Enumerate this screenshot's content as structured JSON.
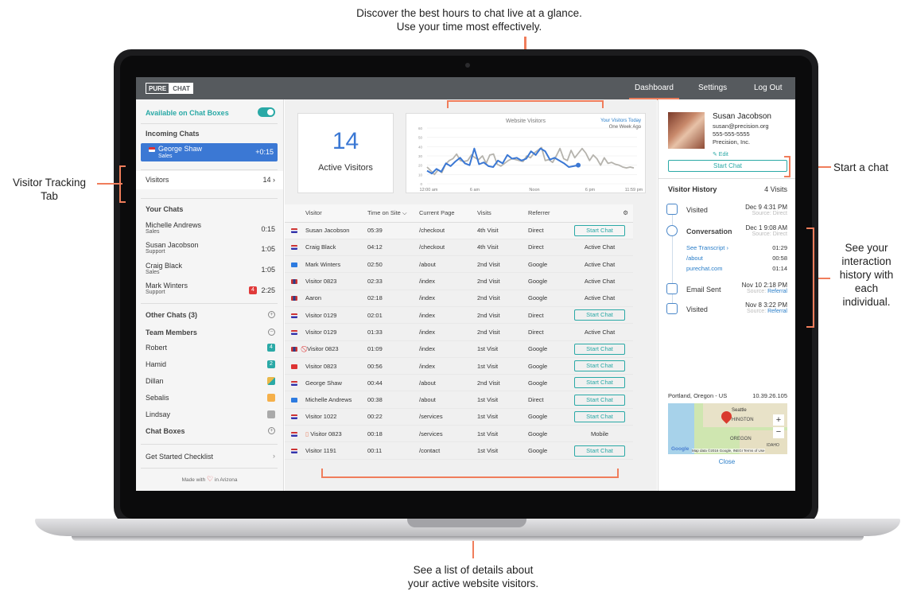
{
  "callouts": {
    "top": [
      "Discover the best hours to chat live at a glance.",
      "Use your time most effectively."
    ],
    "left": [
      "Visitor Tracking",
      "Tab"
    ],
    "right_start": "Start a chat",
    "right_history": [
      "See your",
      "interaction",
      "history with",
      "each",
      "individual."
    ],
    "bottom": [
      "See a list of details about",
      "your active website visitors."
    ]
  },
  "app": {
    "logo": [
      "PURE",
      "CHAT"
    ],
    "nav": {
      "dashboard": "Dashboard",
      "settings": "Settings",
      "logout": "Log Out"
    }
  },
  "sidebar": {
    "available": "Available on Chat Boxes",
    "incoming_title": "Incoming Chats",
    "incoming": {
      "name": "George Shaw",
      "dept": "Sales",
      "time": "+0:15"
    },
    "visitors_label": "Visitors",
    "visitors_count": "14 ›",
    "your_chats_title": "Your Chats",
    "your_chats": [
      {
        "name": "Michelle Andrews",
        "dept": "Sales",
        "time": "0:15",
        "badge": ""
      },
      {
        "name": "Susan Jacobson",
        "dept": "Support",
        "time": "1:05",
        "badge": ""
      },
      {
        "name": "Craig Black",
        "dept": "Sales",
        "time": "1:05",
        "badge": ""
      },
      {
        "name": "Mark Winters",
        "dept": "Support",
        "time": "2:25",
        "badge": "4"
      }
    ],
    "other_chats": "Other Chats (3)",
    "team_title": "Team Members",
    "team": [
      {
        "name": "Robert",
        "badge": "4",
        "color": "#2aa9a6"
      },
      {
        "name": "Hamid",
        "badge": "2",
        "color": "#2aa9a6"
      },
      {
        "name": "Dillan",
        "badge": "",
        "color": "#e9b94a"
      },
      {
        "name": "Sebalis",
        "badge": "",
        "color": "#f5b04a"
      },
      {
        "name": "Lindsay",
        "badge": "",
        "color": "#aaaaaa"
      }
    ],
    "chat_boxes": "Chat Boxes",
    "checklist": "Get Started Checklist",
    "made_with": "Made with",
    "in_arizona": "in Arizona"
  },
  "active": {
    "count": "14",
    "label": "Active Visitors"
  },
  "chart_data": {
    "type": "line",
    "title": "Website Visitors",
    "legend": [
      "Your Visitors Today",
      "One Week Ago"
    ],
    "x_tick_labels": [
      "12:00 am",
      "6 am",
      "Noon",
      "6 pm",
      "11:59 pm"
    ],
    "y_tick_labels": [
      "60",
      "50",
      "40",
      "30",
      "20",
      "10",
      "0"
    ],
    "ylim": [
      0,
      60
    ],
    "series": [
      {
        "name": "Your Visitors Today",
        "color": "#3b78d4",
        "values": [
          14,
          11,
          16,
          13,
          22,
          19,
          24,
          28,
          22,
          20,
          38,
          21,
          23,
          19,
          18,
          25,
          22,
          31,
          27,
          28,
          25,
          27,
          35,
          31,
          38,
          35,
          26,
          28,
          25,
          22,
          18,
          19,
          20
        ]
      },
      {
        "name": "One Week Ago",
        "color": "#b5b3ad",
        "values": [
          18,
          14,
          10,
          15,
          12,
          21,
          25,
          27,
          32,
          25,
          24,
          25,
          31,
          28,
          26,
          30,
          22,
          31,
          32,
          21,
          19,
          22,
          25,
          27,
          26,
          25,
          24,
          30,
          28,
          33,
          36,
          39,
          25,
          26,
          23,
          30,
          38,
          27,
          25,
          36,
          28,
          33,
          38,
          33,
          25,
          31,
          27,
          20,
          28,
          22,
          23,
          21,
          20,
          18,
          17,
          18,
          17
        ]
      }
    ]
  },
  "visitors_table": {
    "headers": [
      "Visitor",
      "Time on Site ⌵",
      "Current Page",
      "Visits",
      "Referrer"
    ],
    "rows": [
      {
        "flag": "us",
        "name": "Susan Jacobson",
        "time": "05:39",
        "page": "/checkout",
        "visits": "4th Visit",
        "ref": "Direct",
        "action": "Start Chat",
        "btn": true
      },
      {
        "flag": "us",
        "name": "Craig Black",
        "time": "04:12",
        "page": "/checkout",
        "visits": "4th Visit",
        "ref": "Direct",
        "action": "Active Chat",
        "btn": false
      },
      {
        "flag": "br",
        "name": "Mark Winters",
        "time": "02:50",
        "page": "/about",
        "visits": "2nd Visit",
        "ref": "Google",
        "action": "Active Chat",
        "btn": false
      },
      {
        "flag": "uk",
        "name": "Visitor 0823",
        "time": "02:33",
        "page": "/index",
        "visits": "2nd Visit",
        "ref": "Google",
        "action": "Active Chat",
        "btn": false
      },
      {
        "flag": "uk",
        "name": "Aaron",
        "time": "02:18",
        "page": "/index",
        "visits": "2nd Visit",
        "ref": "Google",
        "action": "Active Chat",
        "btn": false
      },
      {
        "flag": "us",
        "name": "Visitor 0129",
        "time": "02:01",
        "page": "/index",
        "visits": "2nd Visit",
        "ref": "Direct",
        "action": "Start Chat",
        "btn": true
      },
      {
        "flag": "us",
        "name": "Visitor 0129",
        "time": "01:33",
        "page": "/index",
        "visits": "2nd Visit",
        "ref": "Direct",
        "action": "Active Chat",
        "btn": false
      },
      {
        "flag": "uk",
        "name": "Visitor 0823",
        "time": "01:09",
        "page": "/index",
        "visits": "1st Visit",
        "ref": "Google",
        "action": "Start Chat",
        "btn": true,
        "blocked": true
      },
      {
        "flag": "tr",
        "name": "Visitor 0823",
        "time": "00:56",
        "page": "/index",
        "visits": "1st Visit",
        "ref": "Google",
        "action": "Start Chat",
        "btn": true
      },
      {
        "flag": "us",
        "name": "George Shaw",
        "time": "00:44",
        "page": "/about",
        "visits": "2nd Visit",
        "ref": "Google",
        "action": "Start Chat",
        "btn": true
      },
      {
        "flag": "br",
        "name": "Michelle Andrews",
        "time": "00:38",
        "page": "/about",
        "visits": "1st Visit",
        "ref": "Direct",
        "action": "Start Chat",
        "btn": true
      },
      {
        "flag": "us",
        "name": "Visitor 1022",
        "time": "00:22",
        "page": "/services",
        "visits": "1st Visit",
        "ref": "Google",
        "action": "Start Chat",
        "btn": true
      },
      {
        "flag": "us",
        "name": "Visitor 0823",
        "time": "00:18",
        "page": "/services",
        "visits": "1st Visit",
        "ref": "Google",
        "action": "Mobile",
        "btn": false,
        "mobile": true
      },
      {
        "flag": "us",
        "name": "Visitor 1191",
        "time": "00:11",
        "page": "/contact",
        "visits": "1st Visit",
        "ref": "Google",
        "action": "Start Chat",
        "btn": true
      }
    ]
  },
  "profile": {
    "name": "Susan Jacobson",
    "email": "susan@precision.org",
    "phone": "555-555-5555",
    "company": "Precision, Inc.",
    "edit": "✎ Edit",
    "start_chat": "Start Chat"
  },
  "history": {
    "title": "Visitor History",
    "count": "4 Visits",
    "items": [
      {
        "label": "Visited",
        "date": "Dec 9 4:31 PM",
        "source": "Source:",
        "source_val": "Direct"
      },
      {
        "label": "Conversation",
        "date": "Dec 1 9:08 AM",
        "source": "Source:",
        "source_val": "Direct"
      },
      {
        "label": "Email Sent",
        "date": "Nov 10 2:18 PM",
        "source": "Source:",
        "source_val": "Referral"
      },
      {
        "label": "Visited",
        "date": "Nov 8 3:22 PM",
        "source": "Source:",
        "source_val": "Referral"
      }
    ],
    "transcript": [
      {
        "page": "See Transcript ›",
        "time": "01:29"
      },
      {
        "page": "/about",
        "time": "00:58"
      },
      {
        "page": "purechat.com",
        "time": "01:14"
      }
    ]
  },
  "location": {
    "place": "Portland, Oregon - US",
    "ip": "10.39.26.105",
    "map_labels": [
      "Seattle",
      "HINGTON",
      "OREGON",
      "IDAHO"
    ],
    "map_footer": "Map data ©2016 Google, INEGI   Terms of Use",
    "google": "Google",
    "close": "Close"
  }
}
